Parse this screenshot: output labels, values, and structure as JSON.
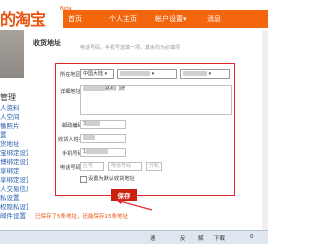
{
  "logo": {
    "text": "的淘宝",
    "badge": "Beta"
  },
  "topnav": {
    "items": [
      "首页",
      "个人主页",
      "帐户设置",
      "消息"
    ],
    "caret": "▾"
  },
  "sidebar": {
    "heading": "管理",
    "items": [
      "人资料",
      "人空间",
      "像照片",
      "置",
      "货地址",
      "宝绑定设置",
      "博绑定设置",
      "享绑定",
      "享绑定设置",
      "人交易信息",
      "私设置",
      "权隐私设置",
      "邮件设置"
    ]
  },
  "section": {
    "title": "收货地址",
    "hint": "电话号码，手机号选填一项，其余均为必填项"
  },
  "form": {
    "region_label": "所在地区*",
    "region_country": "中国大陆",
    "region_province": "",
    "region_city": "",
    "detail_label": "详细地址*",
    "detail_value": "路和门牌",
    "zip_label": "邮政编码*",
    "zip_value": "3",
    "name_label": "收货人姓名*",
    "name_value": "",
    "mobile_label": "手机号码",
    "mobile_value": "1",
    "phone_label": "电话号码",
    "phone_area": "区号",
    "phone_number": "电话号码",
    "phone_ext": "分机",
    "default_label": "设置为默认收货地址",
    "save_label": "保存",
    "saved_note": "已保存了5条地址，还能保存15条地址"
  },
  "taskbar": {
    "items": [
      "速",
      "反",
      "解",
      "下载",
      "0"
    ]
  },
  "colors": {
    "brand": "#f4660d",
    "highlight": "#e0262a",
    "save": "#c9200f"
  }
}
